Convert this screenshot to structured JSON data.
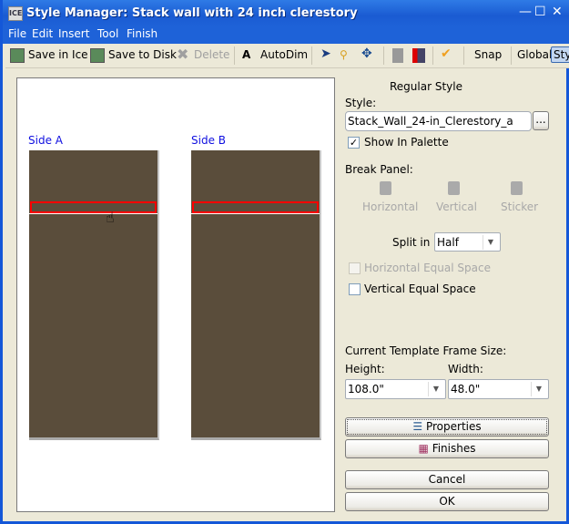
{
  "window": {
    "title": "Style Manager: Stack wall with 24 inch clerestory",
    "app_icon": "ICE",
    "controls": [
      "minimize",
      "maximize",
      "close"
    ]
  },
  "menu": [
    "File",
    "Edit",
    "Insert",
    "Tool",
    "Finish"
  ],
  "toolbar": {
    "save_ice": "Save in Ice",
    "save_disk": "Save to Disk",
    "delete": "Delete",
    "autodim": "AutoDim",
    "snap": "Snap",
    "global": "Global",
    "style": "Sty"
  },
  "canvas": {
    "side_a": "Side A",
    "side_b": "Side B",
    "panel_color": "#5a4d3b",
    "selection_color": "#ff0000"
  },
  "panel": {
    "heading": "Regular Style",
    "style_label": "Style:",
    "style_value": "Stack_Wall_24-in_Clerestory_a",
    "browse": "...",
    "show_in_palette": "Show In Palette",
    "show_in_palette_checked": true,
    "break_panel": "Break Panel:",
    "break_horizontal": "Horizontal",
    "break_vertical": "Vertical",
    "break_sticker": "Sticker",
    "split_in": "Split in",
    "split_value": "Half",
    "horizontal_equal": "Horizontal Equal Space",
    "vertical_equal": "Vertical Equal Space",
    "frame_size": "Current Template Frame Size:",
    "height_label": "Height:",
    "height_value": "108.0\"",
    "width_label": "Width:",
    "width_value": "48.0\"",
    "properties": "Properties",
    "finishes": "Finishes",
    "cancel": "Cancel",
    "ok": "OK"
  }
}
